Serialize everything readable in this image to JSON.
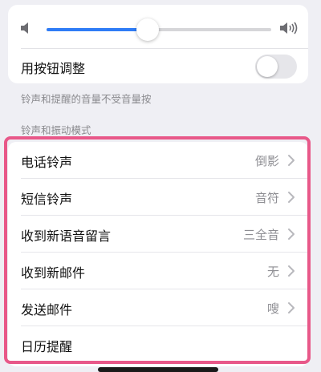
{
  "volume": {
    "level_fraction": 0.45,
    "low_icon": "speaker-low-icon",
    "high_icon": "speaker-high-icon",
    "accent_color": "#2f7cf6"
  },
  "change_with_buttons": {
    "label": "用按钮调整",
    "on": false
  },
  "footnote": "铃声和提醒的音量不受音量按",
  "section_header": "铃声和振动模式",
  "rows": [
    {
      "label": "电话铃声",
      "value": "倒影",
      "has_chevron": true
    },
    {
      "label": "短信铃声",
      "value": "音符",
      "has_chevron": true
    },
    {
      "label": "收到新语音留言",
      "value": "三全音",
      "has_chevron": true
    },
    {
      "label": "收到新邮件",
      "value": "无",
      "has_chevron": true
    },
    {
      "label": "发送邮件",
      "value": "嗖",
      "has_chevron": true
    },
    {
      "label": "日历提醒",
      "value": "",
      "has_chevron": false
    }
  ],
  "highlight_color": "#e85889"
}
